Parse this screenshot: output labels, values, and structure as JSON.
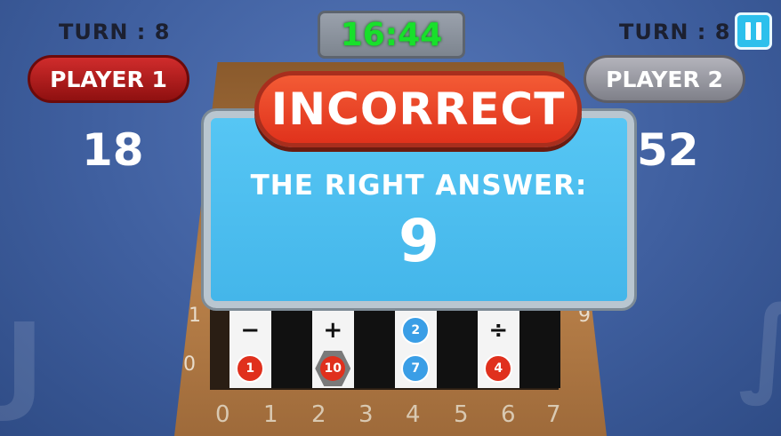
{
  "hud": {
    "turn_left": "TURN : 8",
    "turn_right": "TURN : 8",
    "timer": "16:44",
    "pause_icon": "pause-icon"
  },
  "players": {
    "p1_label": "PLAYER 1",
    "p2_label": "PLAYER 2",
    "p1_score": "18",
    "p2_score": "52"
  },
  "popup": {
    "title": "INCORRECT",
    "subtitle": "THE RIGHT ANSWER:",
    "answer": "9"
  },
  "board": {
    "row_top": [
      "−",
      "",
      "+",
      "",
      "2",
      "",
      "÷",
      ""
    ],
    "row_bottom": [
      "1",
      "",
      "10",
      "",
      "7",
      "",
      "4",
      ""
    ],
    "x_axis": [
      "0",
      "1",
      "2",
      "3",
      "4",
      "5",
      "6",
      "7"
    ],
    "y_axis_left": [
      "1",
      "0"
    ],
    "y_axis_right_top": "9"
  },
  "colors": {
    "accent_red": "#e0321c",
    "panel_blue": "#4ab9ec",
    "timer_green": "#18e02b"
  }
}
